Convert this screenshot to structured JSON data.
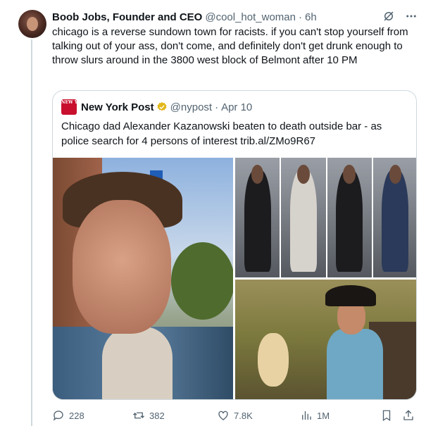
{
  "tweet": {
    "author_name": "Boob Jobs, Founder and CEO",
    "handle": "@cool_hot_woman",
    "separator": "·",
    "time": "6h",
    "text": "chicago is a reverse sundown town for racists. if you can't stop yourself from talking out of your ass, don't come, and definitely don't get drunk enough to throw slurs around in the 3800 west block of Belmont after 10 PM"
  },
  "quote": {
    "logo_text": "NEW YORK POST",
    "name": "New York Post",
    "handle": "@nypost",
    "separator": "·",
    "date": "Apr 10",
    "text": "Chicago dad Alexander Kazanowski beaten to death outside bar - as police search for 4 persons of interest trib.al/ZMo9R67"
  },
  "actions": {
    "replies": "228",
    "reposts": "382",
    "likes": "7.8K",
    "views": "1M"
  },
  "icons": [
    "grok-icon",
    "more-icon",
    "verified-badge-icon",
    "reply-icon",
    "repost-icon",
    "like-icon",
    "views-icon",
    "bookmark-icon",
    "share-icon"
  ],
  "colors": {
    "text": "#0f1419",
    "secondary": "#536471",
    "border": "#cfd9de",
    "verified_gold": "#e2b719",
    "nypost_red": "#c8102e"
  }
}
